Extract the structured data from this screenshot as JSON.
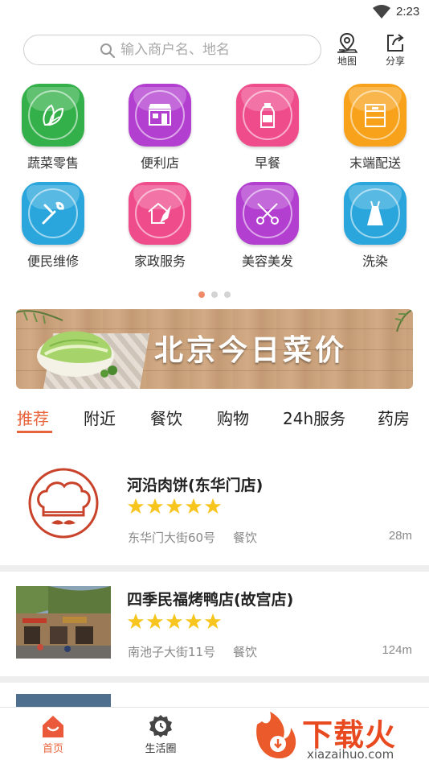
{
  "status_bar": {
    "time": "2:23",
    "wifi_icon": "wifi-icon"
  },
  "search": {
    "placeholder": "输入商户名、地名",
    "icon": "search-icon"
  },
  "top_actions": [
    {
      "label": "地图",
      "icon": "map-pin-icon"
    },
    {
      "label": "分享",
      "icon": "share-icon"
    }
  ],
  "categories": [
    {
      "label": "蔬菜零售",
      "icon": "vegetable-icon",
      "color": "#34b04a"
    },
    {
      "label": "便利店",
      "icon": "store-icon",
      "color": "#b23fd0"
    },
    {
      "label": "早餐",
      "icon": "milk-bottle-icon",
      "color": "#ef4c8c"
    },
    {
      "label": "末端配送",
      "icon": "parcel-box-icon",
      "color": "#f7a21a"
    },
    {
      "label": "便民维修",
      "icon": "wrench-icon",
      "color": "#2aa6dc"
    },
    {
      "label": "家政服务",
      "icon": "broom-house-icon",
      "color": "#ef4c8c"
    },
    {
      "label": "美容美发",
      "icon": "scissors-icon",
      "color": "#b23fd0"
    },
    {
      "label": "洗染",
      "icon": "dress-icon",
      "color": "#2aa6dc"
    }
  ],
  "pager": {
    "pages": 3,
    "active": 0,
    "active_color": "#f08a68"
  },
  "banner": {
    "title": "北京今日菜价"
  },
  "tabs": [
    {
      "label": "推荐",
      "active": true
    },
    {
      "label": "附近",
      "active": false
    },
    {
      "label": "餐饮",
      "active": false
    },
    {
      "label": "购物",
      "active": false
    },
    {
      "label": "24h服务",
      "active": false
    },
    {
      "label": "药房",
      "active": false
    }
  ],
  "accent_color": "#e8643a",
  "merchants": [
    {
      "name": "河沿肉饼(东华门店)",
      "rating": 5,
      "address": "东华门大街60号",
      "category": "餐饮",
      "distance": "28m",
      "thumb": "chef-hat-logo"
    },
    {
      "name": "四季民福烤鸭店(故宫店)",
      "rating": 5,
      "address": "南池子大街11号",
      "category": "餐饮",
      "distance": "124m",
      "thumb": "storefront-photo"
    }
  ],
  "bottom_nav": [
    {
      "label": "首页",
      "icon": "home-icon",
      "active": true
    },
    {
      "label": "生活圈",
      "icon": "life-circle-icon",
      "active": false
    }
  ],
  "watermark": {
    "text": "下载火",
    "sub": "xiazaihuo.com"
  }
}
